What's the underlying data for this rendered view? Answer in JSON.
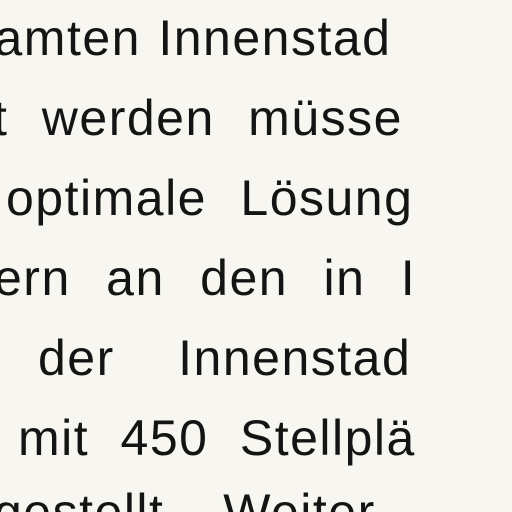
{
  "document": {
    "lines": [
      "samten Innenstad",
      "t werden müsse",
      "optimale Lösung",
      "ern an den in I",
      "der Innenstad",
      "mit 450 Stellplä",
      "gestellt. Weiter"
    ]
  }
}
